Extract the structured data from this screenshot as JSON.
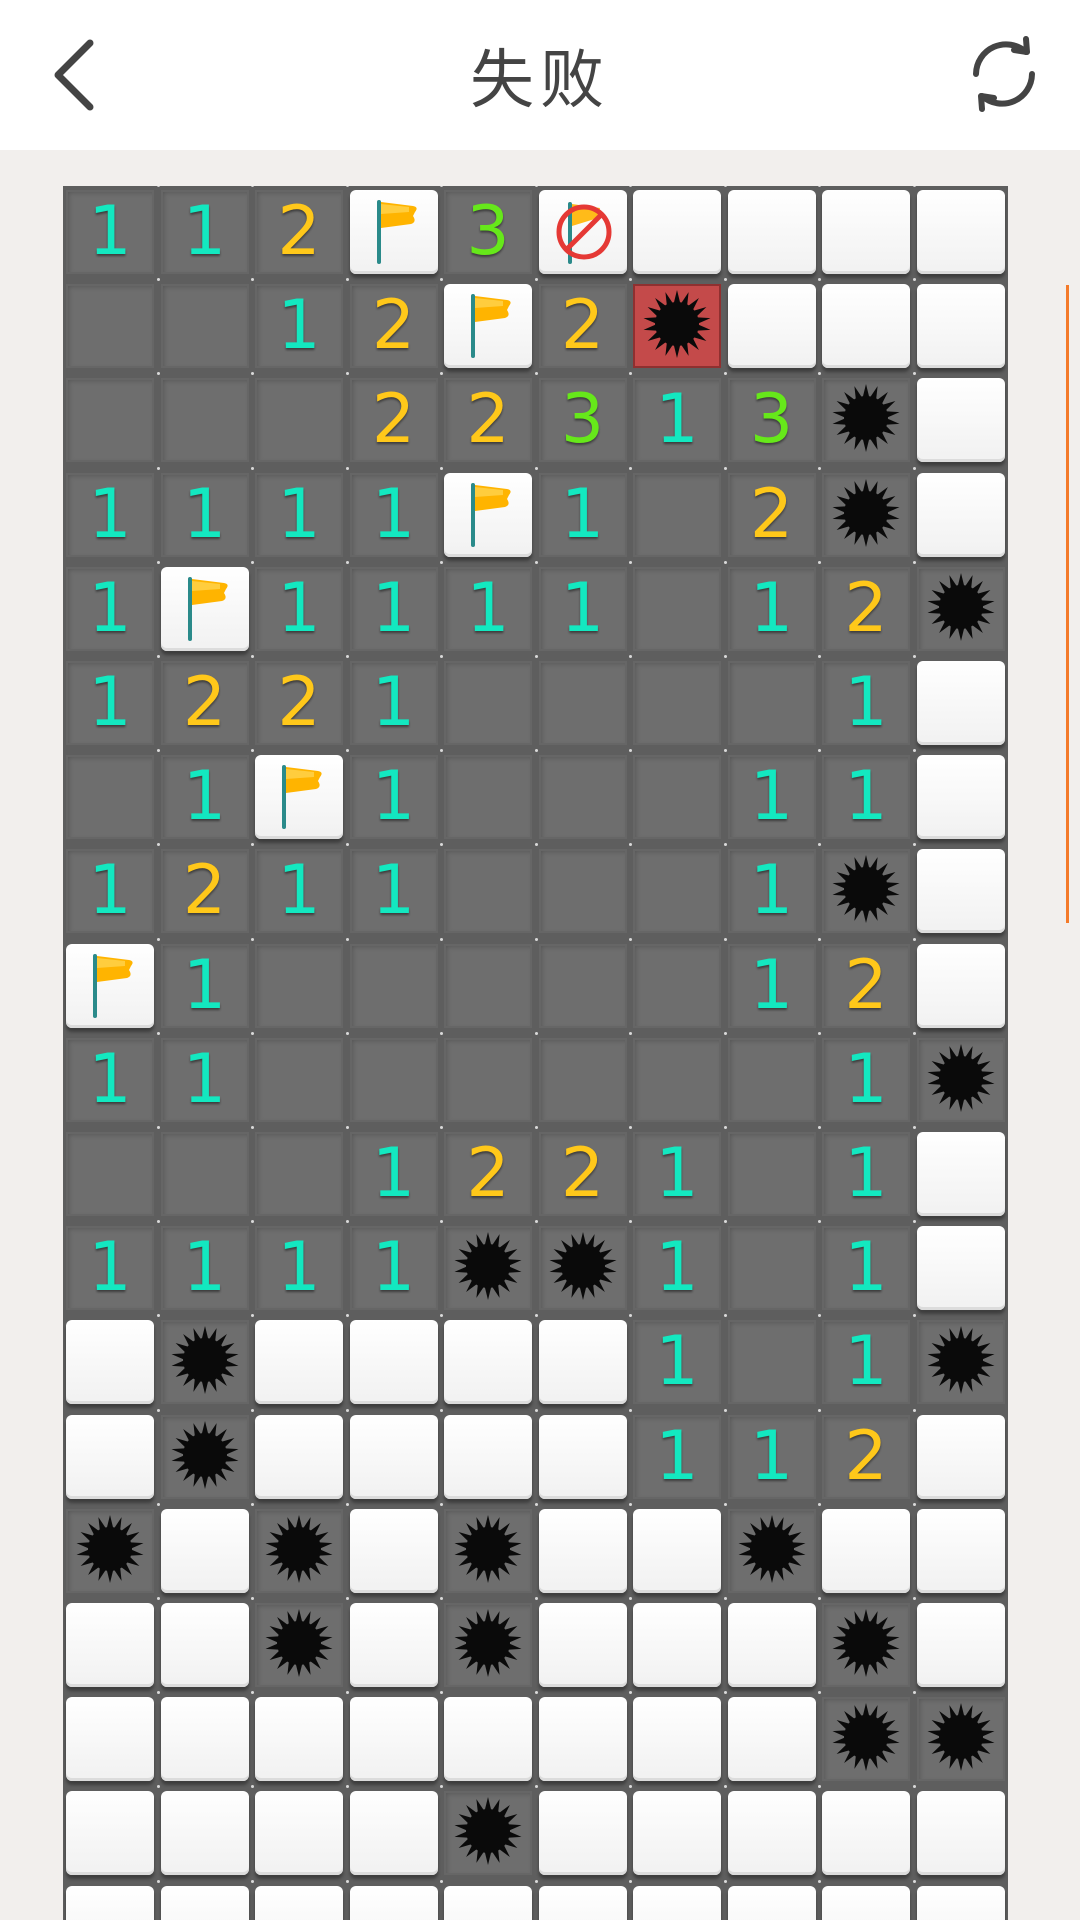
{
  "header": {
    "title": "失败",
    "back_icon": "chevron-left-icon",
    "restart_icon": "refresh-icon"
  },
  "board": {
    "columns": 10,
    "rows_visible": 18,
    "legend": {
      "C": "unopened tile",
      "F": "flag",
      "X": "wrong flag",
      "M": "mine",
      "B": "exploded mine",
      "0": "empty opened",
      "1-8": "adjacent mine count"
    },
    "grid": [
      [
        "1",
        "1",
        "2",
        "F",
        "3",
        "X",
        "C",
        "C",
        "C",
        "C"
      ],
      [
        "0",
        "0",
        "1",
        "2",
        "F",
        "2",
        "B",
        "C",
        "C",
        "C"
      ],
      [
        "0",
        "0",
        "0",
        "2",
        "2",
        "3",
        "1",
        "3",
        "M",
        "C"
      ],
      [
        "1",
        "1",
        "1",
        "1",
        "F",
        "1",
        "0",
        "2",
        "M",
        "C"
      ],
      [
        "1",
        "F",
        "1",
        "1",
        "1",
        "1",
        "0",
        "1",
        "2",
        "M"
      ],
      [
        "1",
        "2",
        "2",
        "1",
        "0",
        "0",
        "0",
        "0",
        "1",
        "C"
      ],
      [
        "0",
        "1",
        "F",
        "1",
        "0",
        "0",
        "0",
        "1",
        "1",
        "C"
      ],
      [
        "1",
        "2",
        "1",
        "1",
        "0",
        "0",
        "0",
        "1",
        "M",
        "C"
      ],
      [
        "F",
        "1",
        "0",
        "0",
        "0",
        "0",
        "0",
        "1",
        "2",
        "C"
      ],
      [
        "1",
        "1",
        "0",
        "0",
        "0",
        "0",
        "0",
        "0",
        "1",
        "M"
      ],
      [
        "0",
        "0",
        "0",
        "1",
        "2",
        "2",
        "1",
        "0",
        "1",
        "C"
      ],
      [
        "1",
        "1",
        "1",
        "1",
        "M",
        "M",
        "1",
        "0",
        "1",
        "C"
      ],
      [
        "C",
        "M",
        "C",
        "C",
        "C",
        "C",
        "1",
        "0",
        "1",
        "M"
      ],
      [
        "C",
        "M",
        "C",
        "C",
        "C",
        "C",
        "1",
        "1",
        "2",
        "C"
      ],
      [
        "M",
        "C",
        "M",
        "C",
        "M",
        "C",
        "C",
        "M",
        "C",
        "C"
      ],
      [
        "C",
        "C",
        "M",
        "C",
        "M",
        "C",
        "C",
        "C",
        "M",
        "C"
      ],
      [
        "C",
        "C",
        "C",
        "C",
        "C",
        "C",
        "C",
        "C",
        "M",
        "M"
      ],
      [
        "C",
        "C",
        "C",
        "C",
        "M",
        "C",
        "C",
        "C",
        "C",
        "C"
      ],
      [
        "C",
        "C",
        "C",
        "C",
        "C",
        "C",
        "C",
        "C",
        "C",
        "C"
      ]
    ],
    "colors": {
      "num1": "#13e8c0",
      "num2": "#ffc81a",
      "num3": "#66e81a",
      "flag": "#ffb400",
      "exploded": "#c44a4a",
      "no_sign": "#e53935"
    }
  },
  "scrollbar_color": "#f47a2a"
}
